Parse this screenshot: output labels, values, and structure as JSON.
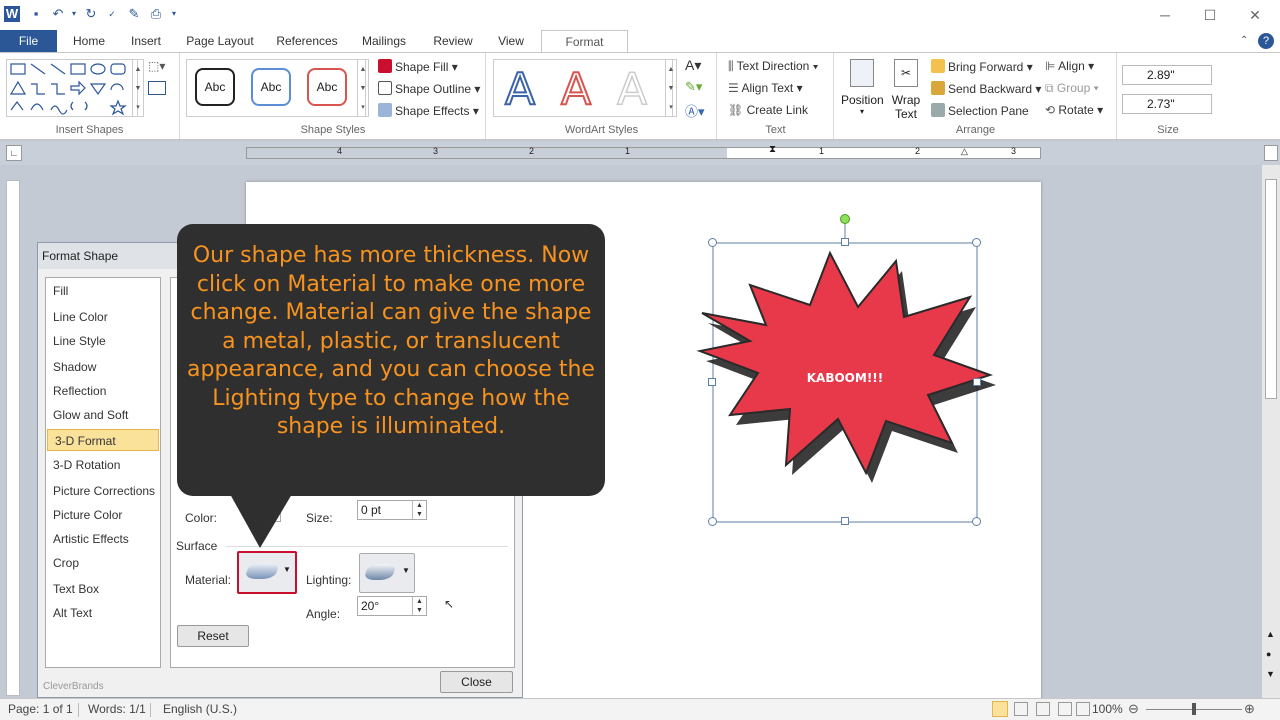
{
  "quick_access": {
    "app_icon": "word-icon",
    "buttons": [
      "save-icon",
      "undo-icon",
      "redo-icon",
      "spelling-icon",
      "print-preview-icon",
      "customize-icon"
    ]
  },
  "window_controls": {
    "minimize": "─",
    "maximize": "☐",
    "close": "✕"
  },
  "tabs": [
    "File",
    "Home",
    "Insert",
    "Page Layout",
    "References",
    "Mailings",
    "Review",
    "View",
    "Format"
  ],
  "ribbon": {
    "insert_shapes": {
      "label": "Insert Shapes"
    },
    "shape_styles": {
      "label": "Shape Styles",
      "presets": [
        "Abc",
        "Abc",
        "Abc"
      ],
      "fill": "Shape Fill",
      "outline": "Shape Outline",
      "effects": "Shape Effects"
    },
    "wordart": {
      "label": "WordArt Styles",
      "letter": "A"
    },
    "text": {
      "label": "Text",
      "direction": "Text Direction",
      "align": "Align Text",
      "link": "Create Link"
    },
    "arrange": {
      "label": "Arrange",
      "position": "Position",
      "wrap_text_1": "Wrap",
      "wrap_text_2": "Text",
      "bring_forward": "Bring Forward",
      "send_backward": "Send Backward",
      "selection_pane": "Selection Pane",
      "align": "Align",
      "group": "Group",
      "rotate": "Rotate"
    },
    "size": {
      "label": "Size",
      "height": "2.89\"",
      "width": "2.73\""
    }
  },
  "ruler": {
    "numbers": [
      "4",
      "3",
      "2",
      "1",
      "1",
      "2",
      "3"
    ]
  },
  "dialog": {
    "title": "Format Shape",
    "categories": [
      "Fill",
      "Line Color",
      "Line Style",
      "Shadow",
      "Reflection",
      "Glow and Soft Edges",
      "3-D Format",
      "3-D Rotation",
      "Picture Corrections",
      "Picture Color",
      "Artistic Effects",
      "Crop",
      "Text Box",
      "Alt Text"
    ],
    "selected_category": "3-D Format",
    "color_label": "Color:",
    "size_label": "Size:",
    "size_value": "0 pt",
    "surface_label": "Surface",
    "material_label": "Material:",
    "lighting_label": "Lighting:",
    "angle_label": "Angle:",
    "angle_value": "20°",
    "reset_label": "Reset",
    "close_label": "Close",
    "watermark": "CleverBrands"
  },
  "callout": {
    "text": "Our shape has more thickness. Now click on Material to make one more change. Material can give the shape a metal, plastic, or translucent appearance, and you can choose the Lighting type to change how the shape is illuminated."
  },
  "shape": {
    "text": "KABOOM!!!",
    "fill": "#e8394a"
  },
  "status": {
    "page": "Page: 1 of 1",
    "words": "Words: 1/1",
    "language": "English (U.S.)",
    "zoom": "100%"
  },
  "colors": {
    "accent": "#2b5797",
    "callout_text": "#f7931e",
    "highlight": "#fbe29a",
    "material_border": "#c8102e"
  }
}
